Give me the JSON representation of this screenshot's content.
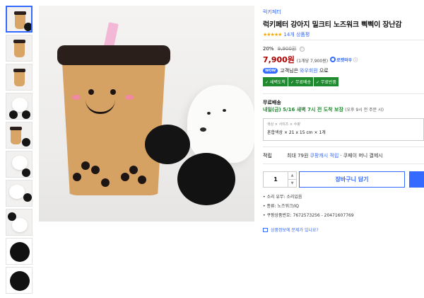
{
  "product": {
    "brand": "럭키페터",
    "title": "럭키페터 강아지 밀크티 노즈워크 삑삑이 장난감",
    "stars": "★★★★★",
    "review_count": "14개 상품평",
    "rating": 5
  },
  "price": {
    "discount_pct": "20%",
    "original": "9,900원",
    "info_icon": "ⓘ",
    "final": "7,900원",
    "unit_price": "(1개당 7,900원)",
    "rocket_label": "로켓와우",
    "rocket_info": "ⓘ"
  },
  "wow": {
    "badge": "WOW",
    "text_before": "고객님은",
    "link": "와우회원",
    "text_after": "으로"
  },
  "benefits": [
    "✓ 새벽도착",
    "✓ 무료배송",
    "✓ 무료반품"
  ],
  "shipping": {
    "title": "무료배송",
    "date": "내일(금) 5/16 새벽 7시 전 도착 보장",
    "cutoff": "(오후 9시 전 주문 시)"
  },
  "option": {
    "label": "색상 × 사이즈 × 수량",
    "value": "혼합색상 × 21 x 15 cm × 1개"
  },
  "accum": {
    "label": "적립",
    "before": "최대 79원",
    "link": "쿠팡캐시 적립",
    "after": "· 쿠페이 머니 결제시"
  },
  "purchase": {
    "quantity": "1",
    "up": "▲",
    "down": "▼",
    "cart_label": "장바구니 담기"
  },
  "specs": [
    "소리 유무: 소리있음",
    "종류: 노즈워크/IQ",
    "쿠팡상품번호: 7672573256 - 20471607769"
  ],
  "report_link": "상품정보에 문제가 있나요?",
  "thumbnail_count": 10,
  "colors": {
    "accent": "#346aff",
    "price_red": "#ae0000",
    "star": "#f6a800",
    "benefit_green": "#1f8a2e"
  }
}
